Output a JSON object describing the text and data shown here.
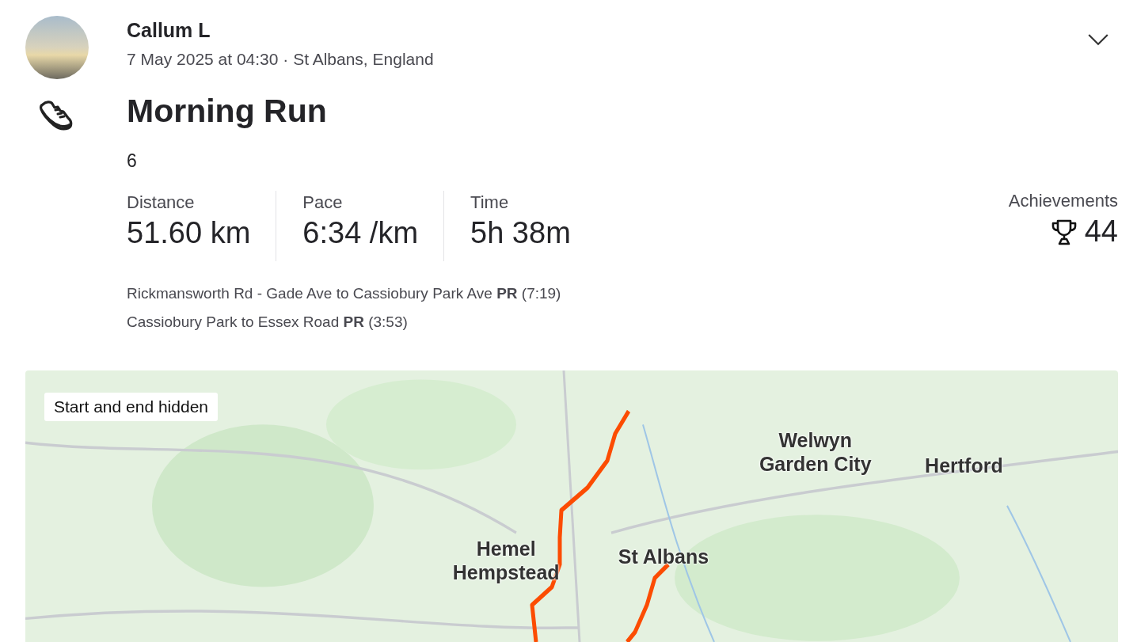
{
  "athlete": {
    "name": "Callum L",
    "meta": "7 May 2025 at 04:30 · St Albans, England"
  },
  "activity": {
    "title": "Morning Run",
    "description": "6"
  },
  "stats": [
    {
      "label": "Distance",
      "value": "51.60 km"
    },
    {
      "label": "Pace",
      "value": "6:34 /km"
    },
    {
      "label": "Time",
      "value": "5h 38m"
    }
  ],
  "achievements": {
    "label": "Achievements",
    "count": "44"
  },
  "segments": [
    "Rickmansworth Rd - Gade Ave to Cassiobury Park Ave **PR** (7:19)",
    "Cassiobury Park to Essex Road **PR** (3:53)"
  ],
  "map": {
    "badge": "Start and end hidden",
    "labels": [
      "Welwyn Garden City",
      "Hertford",
      "Hemel Hempstead",
      "St Albans"
    ]
  }
}
